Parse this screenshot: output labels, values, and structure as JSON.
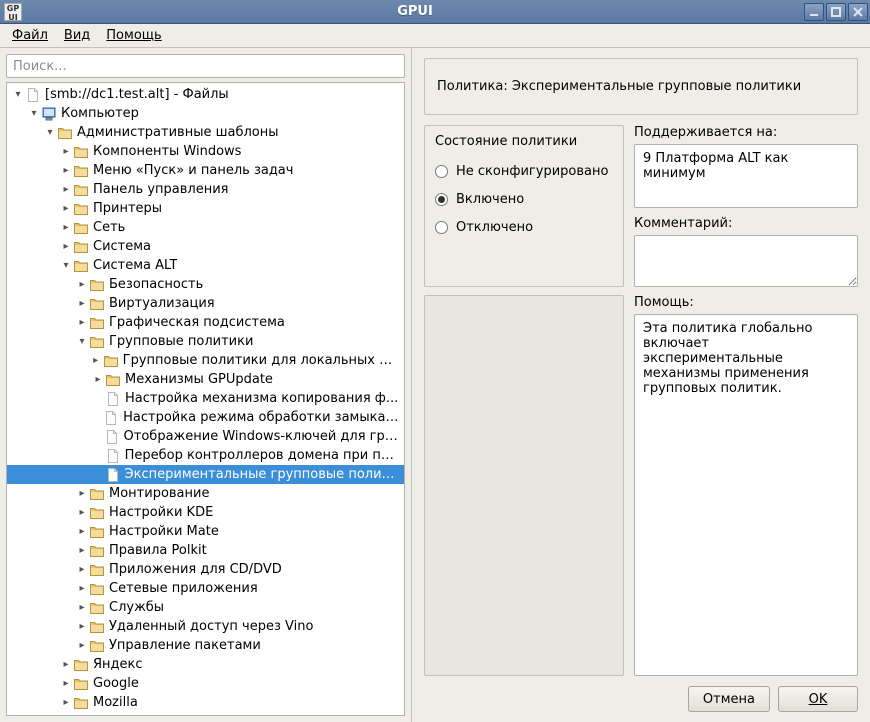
{
  "window": {
    "title": "GPUI"
  },
  "menu": {
    "file": "Файл",
    "view": "Вид",
    "help": "Помощь"
  },
  "search": {
    "placeholder": "Поиск..."
  },
  "tree": [
    {
      "depth": 0,
      "tw": "down",
      "icon": "doc",
      "label": "[smb://dc1.test.alt] - Файлы"
    },
    {
      "depth": 1,
      "tw": "down",
      "icon": "computer",
      "label": "Компьютер"
    },
    {
      "depth": 2,
      "tw": "down",
      "icon": "folder",
      "label": "Административные шаблоны"
    },
    {
      "depth": 3,
      "tw": "right",
      "icon": "folder",
      "label": "Компоненты Windows"
    },
    {
      "depth": 3,
      "tw": "right",
      "icon": "folder",
      "label": "Меню «Пуск» и панель задач"
    },
    {
      "depth": 3,
      "tw": "right",
      "icon": "folder",
      "label": "Панель управления"
    },
    {
      "depth": 3,
      "tw": "right",
      "icon": "folder",
      "label": "Принтеры"
    },
    {
      "depth": 3,
      "tw": "right",
      "icon": "folder",
      "label": "Сеть"
    },
    {
      "depth": 3,
      "tw": "right",
      "icon": "folder",
      "label": "Система"
    },
    {
      "depth": 3,
      "tw": "down",
      "icon": "folder",
      "label": "Система ALT"
    },
    {
      "depth": 4,
      "tw": "right",
      "icon": "folder",
      "label": "Безопасность"
    },
    {
      "depth": 4,
      "tw": "right",
      "icon": "folder",
      "label": "Виртуализация"
    },
    {
      "depth": 4,
      "tw": "right",
      "icon": "folder",
      "label": "Графическая подсистема"
    },
    {
      "depth": 4,
      "tw": "down",
      "icon": "folder",
      "label": "Групповые политики"
    },
    {
      "depth": 5,
      "tw": "right",
      "icon": "folder",
      "label": "Групповые политики для локальных по..."
    },
    {
      "depth": 5,
      "tw": "right",
      "icon": "folder",
      "label": "Механизмы GPUpdate"
    },
    {
      "depth": 5,
      "tw": "none",
      "icon": "doc",
      "label": "Настройка механизма копирования ф..."
    },
    {
      "depth": 5,
      "tw": "none",
      "icon": "doc",
      "label": "Настройка режима обработки замыкан..."
    },
    {
      "depth": 5,
      "tw": "none",
      "icon": "doc",
      "label": "Отображение Windows-ключей для гру..."
    },
    {
      "depth": 5,
      "tw": "none",
      "icon": "doc",
      "label": "Перебор контроллеров домена при по..."
    },
    {
      "depth": 5,
      "tw": "none",
      "icon": "doc",
      "label": "Экспериментальные групповые полит...",
      "selected": true
    },
    {
      "depth": 4,
      "tw": "right",
      "icon": "folder",
      "label": "Монтирование"
    },
    {
      "depth": 4,
      "tw": "right",
      "icon": "folder",
      "label": "Настройки KDE"
    },
    {
      "depth": 4,
      "tw": "right",
      "icon": "folder",
      "label": "Настройки Mate"
    },
    {
      "depth": 4,
      "tw": "right",
      "icon": "folder",
      "label": "Правила Polkit"
    },
    {
      "depth": 4,
      "tw": "right",
      "icon": "folder",
      "label": "Приложения для CD/DVD"
    },
    {
      "depth": 4,
      "tw": "right",
      "icon": "folder",
      "label": "Сетевые приложения"
    },
    {
      "depth": 4,
      "tw": "right",
      "icon": "folder",
      "label": "Службы"
    },
    {
      "depth": 4,
      "tw": "right",
      "icon": "folder",
      "label": "Удаленный доступ через Vino"
    },
    {
      "depth": 4,
      "tw": "right",
      "icon": "folder",
      "label": "Управление пакетами"
    },
    {
      "depth": 3,
      "tw": "right",
      "icon": "folder",
      "label": "Яндекс"
    },
    {
      "depth": 3,
      "tw": "right",
      "icon": "folder",
      "label": "Google"
    },
    {
      "depth": 3,
      "tw": "right",
      "icon": "folder",
      "label": "Mozilla"
    }
  ],
  "policy": {
    "title_prefix": "Политика:",
    "title": "Экспериментальные групповые политики",
    "state_label": "Состояние политики",
    "states": {
      "not_configured": "Не сконфигурировано",
      "enabled": "Включено",
      "disabled": "Отключено",
      "selected": "enabled"
    },
    "supported_label": "Поддерживается на:",
    "supported_value": "9 Платформа ALT как минимум",
    "comment_label": "Комментарий:",
    "comment_value": "",
    "help_label": "Помощь:",
    "help_value": "Эта политика глобально включает экспериментальные механизмы применения групповых политик."
  },
  "buttons": {
    "cancel": "Отмена",
    "ok": "OK"
  }
}
